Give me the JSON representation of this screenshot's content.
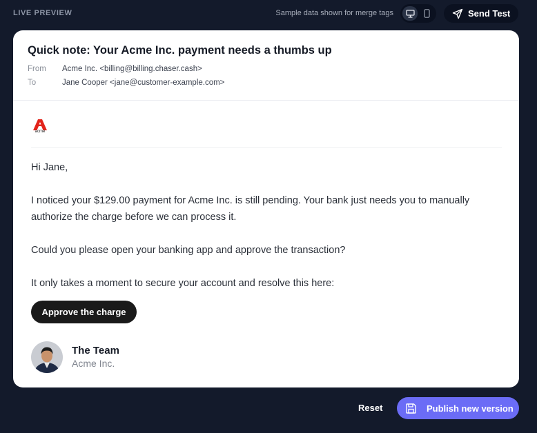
{
  "topbar": {
    "live_label": "LIVE PREVIEW",
    "merge_note": "Sample data shown for merge tags",
    "device_toggle": {
      "active": "desktop",
      "options": [
        "desktop-icon",
        "mobile-icon"
      ]
    },
    "send_test_label": "Send Test"
  },
  "email": {
    "subject": "Quick note: Your Acme Inc. payment needs a thumbs up",
    "from_label": "From",
    "from_value": "Acme Inc. <billing@billing.chaser.cash>",
    "to_label": "To",
    "to_value": "Jane Cooper <jane@customer-example.com>",
    "logo_text": "acme",
    "greeting": "Hi Jane,",
    "paragraph_1": "I noticed your $129.00 payment for Acme Inc. is still pending. Your bank just needs you to manually authorize the charge before we can process it.",
    "paragraph_2": "Could you please open your banking app and approve the transaction?",
    "paragraph_3": "It only takes a moment to secure your account and resolve this here:",
    "cta_label": "Approve the charge",
    "signature_name": "The Team",
    "signature_company": "Acme Inc."
  },
  "footer": {
    "reset_label": "Reset",
    "publish_label": "Publish new version"
  },
  "colors": {
    "background": "#131a2b",
    "accent": "#6b6cf6",
    "logo_red": "#e2231a",
    "cta_dark": "#1a1a1a"
  }
}
